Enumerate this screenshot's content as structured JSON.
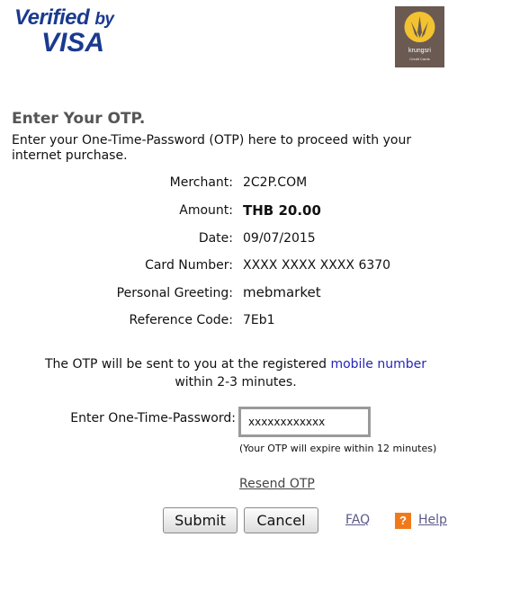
{
  "logos": {
    "visa_line1": "Verified",
    "visa_by": "by",
    "visa_line2": "VISA",
    "bank_name": "krungsri",
    "bank_sub": "Credit Cards"
  },
  "header": {
    "title": "Enter Your OTP.",
    "intro": "Enter your One-Time-Password (OTP) here to proceed with your internet purchase."
  },
  "details": [
    {
      "label": "Merchant:",
      "value": "2C2P.COM"
    },
    {
      "label": "Amount:",
      "value": "THB 20.00"
    },
    {
      "label": "Date:",
      "value": "09/07/2015"
    },
    {
      "label": "Card Number:",
      "value": "XXXX XXXX XXXX 6370"
    },
    {
      "label": "Personal Greeting:",
      "value": "mebmarket"
    },
    {
      "label": "Reference Code:",
      "value": "7Eb1"
    }
  ],
  "notice": {
    "text_before": "The OTP will be sent to you at the registered ",
    "link": "mobile number",
    "text_after": "within 2-3 minutes."
  },
  "otp": {
    "label": "Enter One-Time-Password:",
    "value": "xxxxxxxxxxxx",
    "expire_note": "(Your OTP will expire within 12 minutes)",
    "resend_label": "Resend OTP"
  },
  "actions": {
    "submit_label": "Submit",
    "cancel_label": "Cancel",
    "faq_label": "FAQ",
    "help_icon": "?",
    "help_label": "Help"
  },
  "colors": {
    "visa_blue": "#1a3a8f",
    "link_blue": "#2525b8",
    "help_orange": "#f07a1a",
    "bank_brown": "#6a5a52"
  }
}
